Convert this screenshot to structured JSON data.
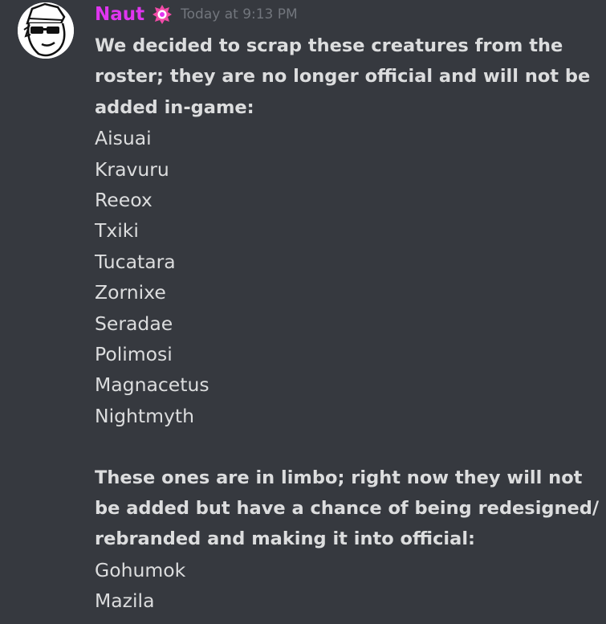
{
  "message": {
    "author": "Naut",
    "timestamp": "Today at 9:13 PM",
    "colors": {
      "username": "#e035f0",
      "text": "#dcddde",
      "timestamp": "#72767d",
      "background": "#36393f"
    },
    "avatar_icon": "cartoon-sunglasses-avatar",
    "role_icon": "pink-crest-icon",
    "intro_lines": [
      "We decided to scrap these creatures from the",
      "roster; they are no longer official and will not be",
      "added in-game:"
    ],
    "scrapped": [
      "Aisuai",
      "Kravuru",
      "Reeox",
      "Txiki",
      "Tucatara",
      "Zornixe",
      "Seradae",
      "Polimosi",
      "Magnacetus",
      "Nightmyth"
    ],
    "limbo_lines": [
      "These ones are in limbo; right now they will not",
      "be added but have a chance of being redesigned/",
      "rebranded and making it into official:"
    ],
    "limbo": [
      "Gohumok",
      "Mazila"
    ]
  }
}
